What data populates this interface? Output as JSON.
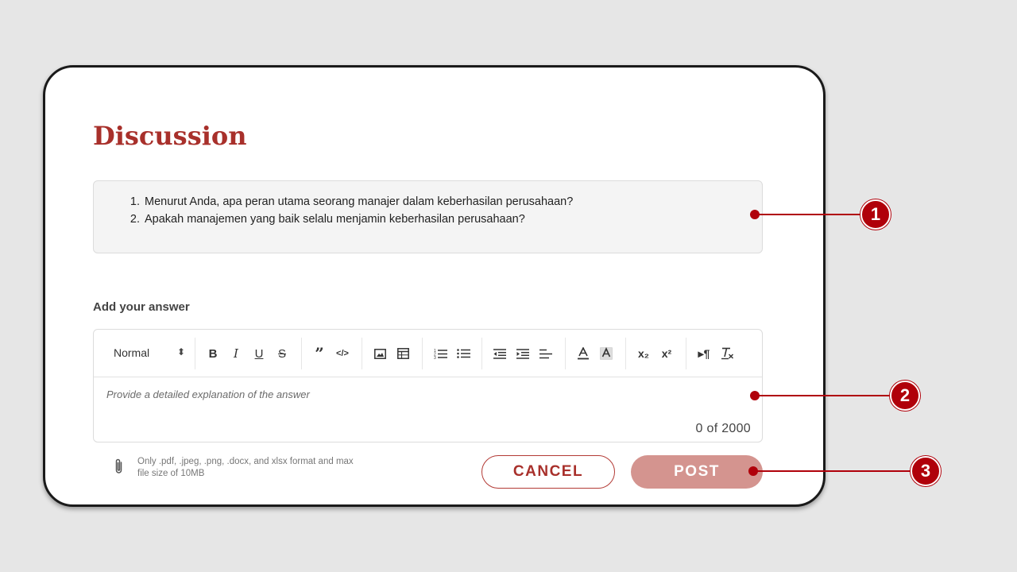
{
  "page": {
    "title": "Discussion"
  },
  "questions": [
    "Menurut Anda, apa peran utama seorang manajer dalam keberhasilan perusahaan?",
    "Apakah manajemen yang baik selalu menjamin keberhasilan perusahaan?"
  ],
  "answer": {
    "label": "Add your answer",
    "format_select": "Normal",
    "placeholder": "Provide a detailed explanation of the answer",
    "counter_current": "0",
    "counter_of": "of",
    "counter_max": "2000"
  },
  "toolbar": {
    "bold": "B",
    "italic": "I",
    "underline": "U",
    "strike": "S",
    "subscript": "x₂",
    "superscript": "x²"
  },
  "attachment": {
    "note": "Only .pdf, .jpeg, .png, .docx, and xlsx format and max file size of 10MB"
  },
  "buttons": {
    "cancel": "CANCEL",
    "post": "POST"
  },
  "callouts": [
    "1",
    "2",
    "3"
  ],
  "colors": {
    "accent": "#a8302b",
    "post_disabled": "#d4948f",
    "callout": "#b0000a"
  }
}
